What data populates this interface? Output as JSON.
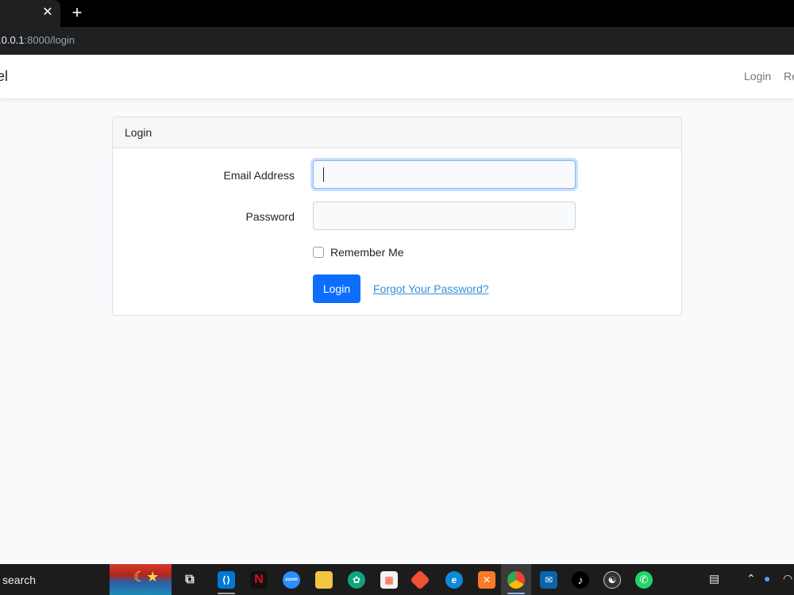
{
  "browser": {
    "tab_close": "✕",
    "new_tab": "+",
    "url_host": ".0.0.1",
    "url_path": ":8000/login"
  },
  "navbar": {
    "brand": "el",
    "login": "Login",
    "register": "Re"
  },
  "card": {
    "header": "Login",
    "email_label": "Email Address",
    "email_value": "",
    "password_label": "Password",
    "password_value": "",
    "remember_label": "Remember Me",
    "remember_checked": false,
    "login_button": "Login",
    "forgot_link": "Forgot Your Password?"
  },
  "taskbar": {
    "search_label": "search",
    "icons": [
      "task-view",
      "vscode",
      "netflix",
      "zoom",
      "file-explorer",
      "chatgpt",
      "microsoft-store",
      "git",
      "edge",
      "xampp",
      "chrome",
      "mail",
      "tiktok",
      "github",
      "whatsapp"
    ],
    "active_app": "chrome"
  },
  "colors": {
    "primary": "#0d6efd",
    "link": "#3490dc",
    "page_bg": "#f8fafc"
  }
}
